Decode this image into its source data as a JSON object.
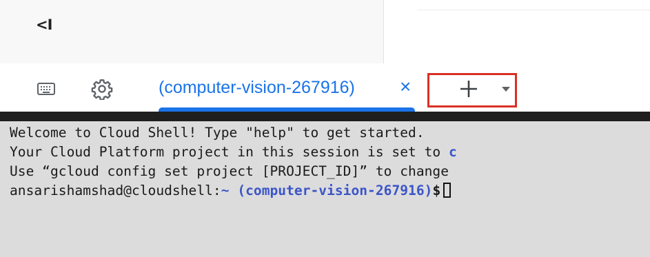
{
  "panel": {
    "collapse_label": "<I"
  },
  "toolbar": {
    "keyboard_icon": "keyboard-icon",
    "settings_icon": "gear-icon",
    "tab": {
      "label": "(computer-vision-267916)",
      "close_glyph": "×",
      "active": true
    },
    "new_tab_icon": "plus-icon",
    "new_tab_menu_icon": "caret-down-icon",
    "highlight_color": "#d93025",
    "accent_color": "#1a73e8"
  },
  "terminal": {
    "line1": "Welcome to Cloud Shell! Type \"help\" to get started.",
    "line2_text": "Your Cloud Platform project in this session is set to ",
    "line2_highlight": "c",
    "line3": "Use “gcloud config set project [PROJECT_ID]” to change",
    "prompt_user": "ansarishamshad@cloudshell:",
    "prompt_tilde": "~",
    "prompt_project": "(computer-vision-267916)",
    "prompt_symbol": "$",
    "prompt_color": "#3b55c9",
    "background": "#dcdcdc"
  }
}
